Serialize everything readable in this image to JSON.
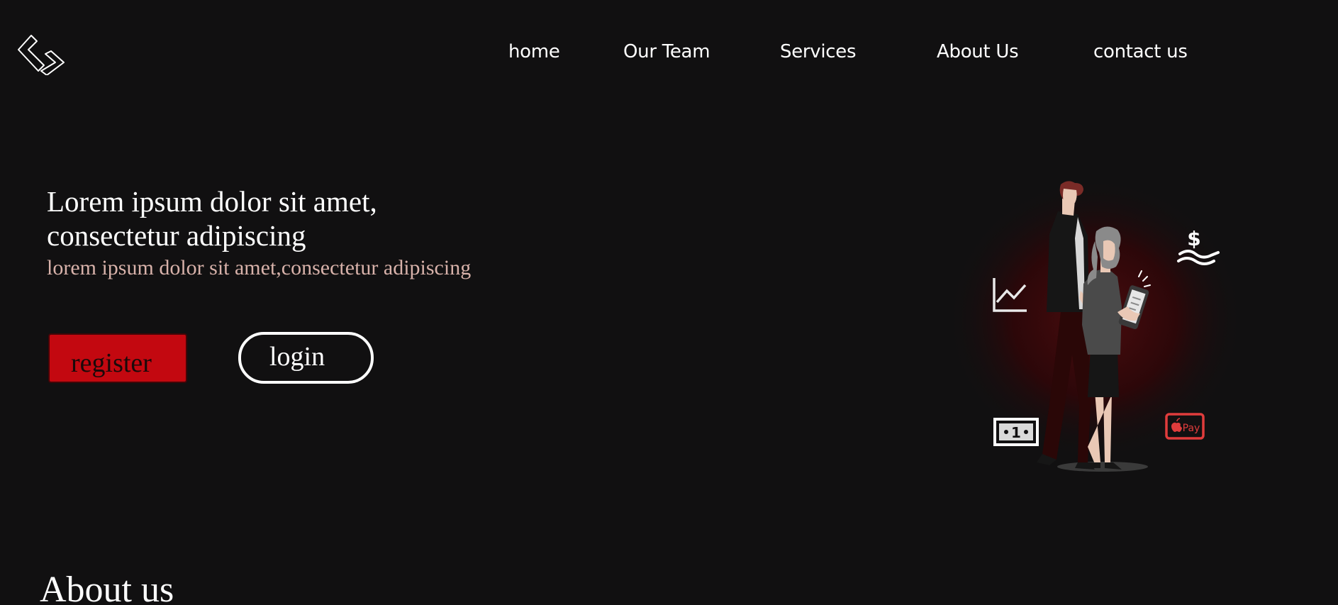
{
  "nav": {
    "items": [
      {
        "label": "home"
      },
      {
        "label": "Our Team"
      },
      {
        "label": "Services"
      },
      {
        "label": "About Us"
      },
      {
        "label": "contact us"
      }
    ]
  },
  "hero": {
    "title": "Lorem ipsum dolor sit amet, consectetur adipiscing",
    "subtitle": "lorem ipsum dolor sit amet,consectetur adipiscing",
    "register_label": "register",
    "login_label": "login"
  },
  "illustration": {
    "dollar_sign": "$",
    "bill_value": "1",
    "pay_badge": "Pay"
  },
  "about": {
    "heading": "About us"
  },
  "colors": {
    "background": "#111011",
    "accent_red": "#c30810",
    "subtitle_pink": "#d8b2aa",
    "text": "#ffffff"
  },
  "icons": [
    "logo-icon",
    "chart-icon",
    "dollar-hand-icon",
    "cash-bill-icon",
    "apple-pay-icon"
  ]
}
